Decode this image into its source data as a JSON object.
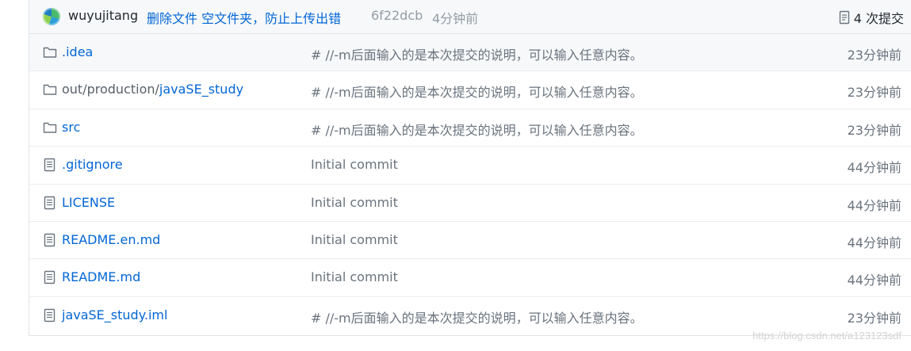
{
  "commit": {
    "author": "wuyujitang",
    "message": "删除文件 空文件夹，防止上传出错",
    "sha": "6f22dcb",
    "time": "4分钟前",
    "history_label": "4 次提交"
  },
  "files": [
    {
      "type": "dir",
      "prefix": "",
      "name": ".idea",
      "message": "# //-m后面输入的是本次提交的说明，可以输入任意内容。",
      "age": "23分钟前",
      "hover": true
    },
    {
      "type": "dir",
      "prefix": "out/production/",
      "name": "javaSE_study",
      "message": "# //-m后面输入的是本次提交的说明，可以输入任意内容。",
      "age": "23分钟前"
    },
    {
      "type": "dir",
      "prefix": "",
      "name": "src",
      "message": "# //-m后面输入的是本次提交的说明，可以输入任意内容。",
      "age": "23分钟前"
    },
    {
      "type": "file",
      "prefix": "",
      "name": ".gitignore",
      "message": "Initial commit",
      "age": "44分钟前"
    },
    {
      "type": "file",
      "prefix": "",
      "name": "LICENSE",
      "message": "Initial commit",
      "age": "44分钟前"
    },
    {
      "type": "file",
      "prefix": "",
      "name": "README.en.md",
      "message": "Initial commit",
      "age": "44分钟前"
    },
    {
      "type": "file",
      "prefix": "",
      "name": "README.md",
      "message": "Initial commit",
      "age": "44分钟前"
    },
    {
      "type": "file",
      "prefix": "",
      "name": "javaSE_study.iml",
      "message": "# //-m后面输入的是本次提交的说明，可以输入任意内容。",
      "age": "23分钟前"
    }
  ],
  "watermark": "https://blog.csdn.net/a123123sdf"
}
